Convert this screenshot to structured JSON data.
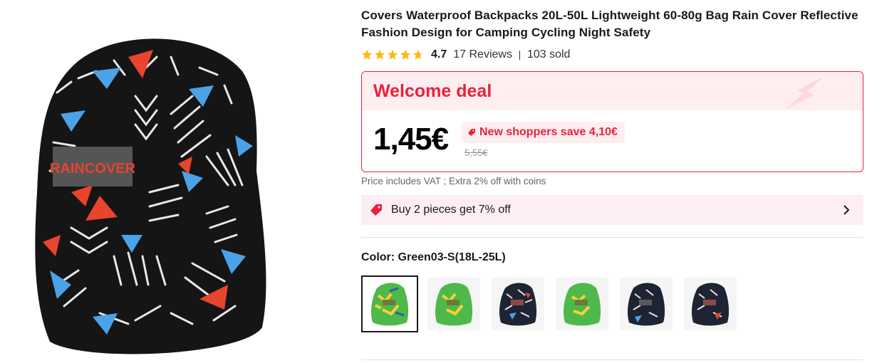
{
  "product": {
    "title": "Covers Waterproof Backpacks 20L-50L Lightweight 60-80g Bag Rain Cover Reflective Fashion Design for Camping Cycling Night Safety",
    "image_label": "RAINCOVER"
  },
  "rating": {
    "stars": 4.7,
    "value": "4.7",
    "reviews": "17 Reviews",
    "sold": "103 sold",
    "star_color": "#fdb813"
  },
  "deal": {
    "title": "Welcome deal",
    "price": "1,45€",
    "save_text": "New shoppers save 4,10€",
    "old_price": "5,55€",
    "accent_color": "#e8223b"
  },
  "vat_note": "Price includes VAT ; Extra 2% off with coins",
  "promo": {
    "text": "Buy 2 pieces get 7% off",
    "icon": "price-tag-icon",
    "arrow_icon": "chevron-right-icon"
  },
  "color": {
    "label": "Color: Green03-S(18L-25L)",
    "options": [
      {
        "variant": "green",
        "selected": true
      },
      {
        "variant": "green",
        "selected": false
      },
      {
        "variant": "black",
        "selected": false
      },
      {
        "variant": "green",
        "selected": false
      },
      {
        "variant": "black",
        "selected": false
      },
      {
        "variant": "black",
        "selected": false
      }
    ]
  }
}
